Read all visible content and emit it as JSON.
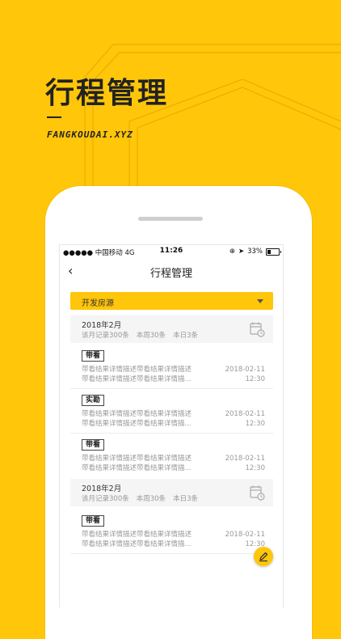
{
  "promo": {
    "headline": "行程管理",
    "domain": "FANGKOUDAI.XYZ"
  },
  "status_bar": {
    "carrier": "●●●●● 中国移动  4G",
    "time": "11:26",
    "battery": "33%"
  },
  "nav": {
    "back_icon": "chevron-left-icon",
    "title": "行程管理"
  },
  "filter": {
    "selected": "开发房源"
  },
  "groups": [
    {
      "month": "2018年2月",
      "stats": [
        "该月记录300条",
        "本周30条",
        "本日3条"
      ],
      "entries": [
        {
          "tag": "带看",
          "line1": "带看结果详情描述带看结果详情描述",
          "line2": "带看结果详情描述带看结果详情描...",
          "date": "2018-02-11",
          "time": "12:30"
        },
        {
          "tag": "实勘",
          "line1": "带看结果详情描述带看结果详情描述",
          "line2": "带看结果详情描述带看结果详情描...",
          "date": "2018-02-11",
          "time": "12:30"
        },
        {
          "tag": "带看",
          "line1": "带看结果详情描述带看结果详情描述",
          "line2": "带看结果详情描述带看结果详情描...",
          "date": "2018-02-11",
          "time": "12:30"
        }
      ]
    },
    {
      "month": "2018年2月",
      "stats": [
        "该月记录300条",
        "本周30条",
        "本日3条"
      ],
      "entries": [
        {
          "tag": "带看",
          "line1": "带看结果详情描述带看结果详情描述",
          "line2": "带看结果详情描述带看结果详情描...",
          "date": "2018-02-11",
          "time": "12:30"
        }
      ]
    }
  ],
  "colors": {
    "accent": "#FFC60A",
    "text_dark": "#222222",
    "text_muted": "#999999"
  },
  "icons": {
    "calendar": "calendar-clock-icon",
    "edit": "pencil-icon"
  }
}
